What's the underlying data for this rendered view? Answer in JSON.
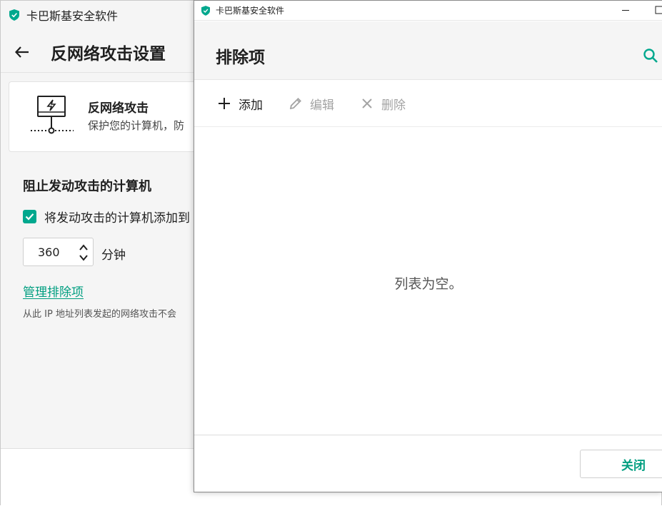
{
  "background_window": {
    "app_title": "卡巴斯基安全软件",
    "page_title": "反网络攻击设置",
    "card": {
      "title": "反网络攻击",
      "description": "保护您的计算机，防"
    },
    "section_title": "阻止发动攻击的计算机",
    "checkbox": {
      "label": "将发动攻击的计算机添加到",
      "checked": true
    },
    "stepper": {
      "value": "360",
      "unit": "分钟"
    },
    "manage_link": "管理排除项",
    "note": "从此 IP 地址列表发起的网络攻击不会"
  },
  "dialog": {
    "window_title": "卡巴斯基安全软件",
    "title": "排除项",
    "toolbar": {
      "add_label": "添加",
      "edit_label": "编辑",
      "delete_label": "删除"
    },
    "empty_message": "列表为空。",
    "close_label": "关闭"
  },
  "colors": {
    "accent": "#00a88e",
    "link": "#009e80",
    "disabled_text": "#a3a3a3"
  },
  "icons": {
    "app": "shield-check-icon",
    "back": "arrow-left-icon",
    "card": "monitor-lightning-network-icon",
    "search": "search-icon",
    "add": "plus-icon",
    "edit": "pencil-icon",
    "delete": "x-icon",
    "minimize": "minimize-icon",
    "maximize": "maximize-icon"
  }
}
